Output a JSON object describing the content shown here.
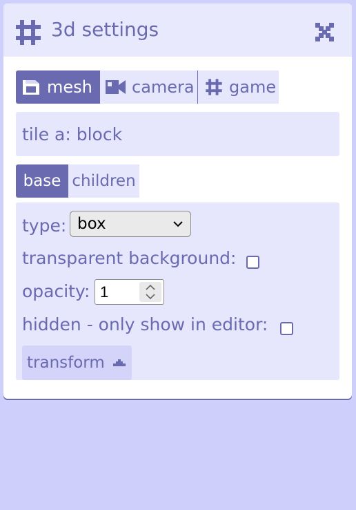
{
  "window": {
    "title": "3d settings",
    "title_icon": "hash-icon",
    "close_icon": "close-icon"
  },
  "tabs": [
    {
      "label": "mesh",
      "icon": "mesh-icon",
      "active": true
    },
    {
      "label": "camera",
      "icon": "camera-icon",
      "active": false
    },
    {
      "label": "game",
      "icon": "hash-icon",
      "active": false
    }
  ],
  "tile_label": "tile a: block",
  "subtabs": [
    {
      "label": "base",
      "active": true
    },
    {
      "label": "children",
      "active": false
    }
  ],
  "form": {
    "type_label": "type:",
    "type_value": "box",
    "transparent_label": "transparent background:",
    "transparent_checked": false,
    "opacity_label": "opacity:",
    "opacity_value": "1",
    "hidden_label": "hidden - only show in editor:",
    "hidden_checked": false,
    "transform_label": "transform"
  },
  "colors": {
    "accent": "#6a6ab0",
    "light_panel": "#e6e6fc",
    "page_background": "#cfcffb",
    "button_background": "#d4d4fb"
  }
}
